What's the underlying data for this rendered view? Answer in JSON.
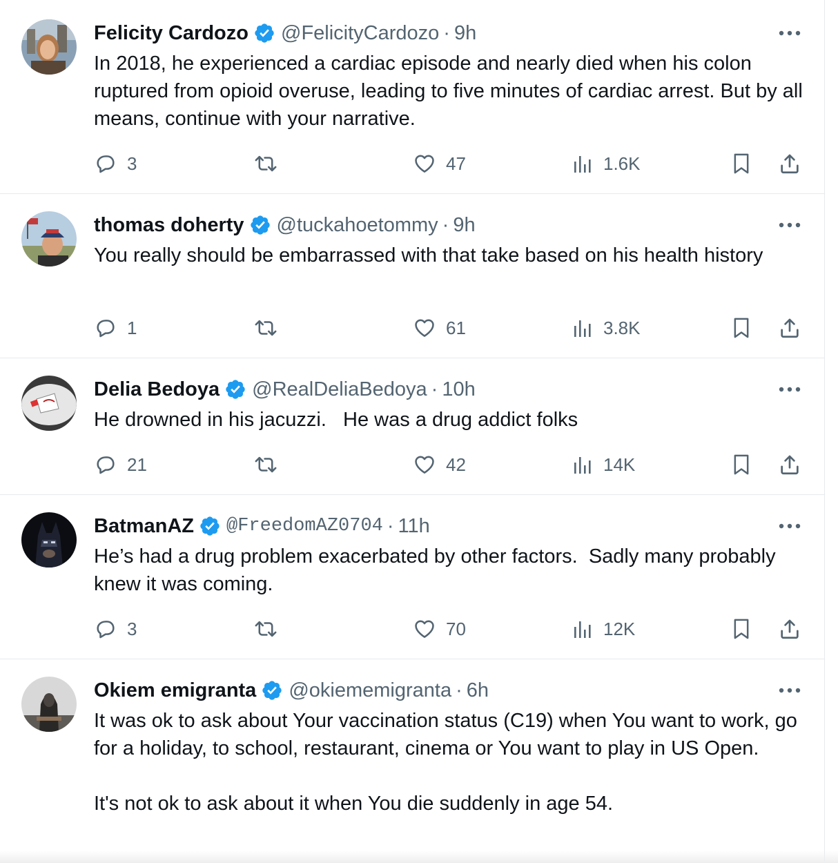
{
  "tweets": [
    {
      "name": "Felicity Cardozo",
      "handle": "@FelicityCardozo",
      "separator": "·",
      "time": "9h",
      "text": "In 2018, he experienced a cardiac episode and nearly died when his colon ruptured from opioid overuse, leading to five minutes of cardiac arrest. But by all means, continue with your narrative.",
      "replies": "3",
      "likes": "47",
      "views": "1.6K"
    },
    {
      "name": "thomas doherty",
      "handle": "@tuckahoetommy",
      "separator": "·",
      "time": "9h",
      "text": "You really should be embarrassed with that take based on his health history",
      "replies": "1",
      "likes": "61",
      "views": "3.8K"
    },
    {
      "name": "Delia Bedoya",
      "handle": "@RealDeliaBedoya",
      "separator": "·",
      "time": "10h",
      "text": "He drowned in his jacuzzi.   He was a drug addict folks",
      "replies": "21",
      "likes": "42",
      "views": "14K"
    },
    {
      "name": "BatmanAZ",
      "handle": "@FreedomAZ0704",
      "separator": "·",
      "time": "11h",
      "text": "He’s had a drug problem exacerbated by other factors.  Sadly many probably knew it was coming.",
      "replies": "3",
      "likes": "70",
      "views": "12K"
    },
    {
      "name": "Okiem emigranta",
      "handle": "@okiememigranta",
      "separator": "·",
      "time": "6h",
      "text": "It was ok to ask about Your vaccination status (C19) when You want to work, go for a holiday, to school, restaurant, cinema or You want to play in US Open.\n\nIt's not ok to ask about it when You die suddenly in age 54."
    }
  ],
  "icons": {
    "more": "more-dots-icon",
    "verified": "verified-badge-icon",
    "reply": "reply-bubble-icon",
    "retweet": "retweet-icon",
    "like": "heart-icon",
    "views": "views-bars-icon",
    "bookmark": "bookmark-icon",
    "share": "share-upload-icon"
  },
  "colors": {
    "text": "#0f1419",
    "secondary": "#536471",
    "verified": "#1d9bf0",
    "border": "#e6e9ec"
  }
}
